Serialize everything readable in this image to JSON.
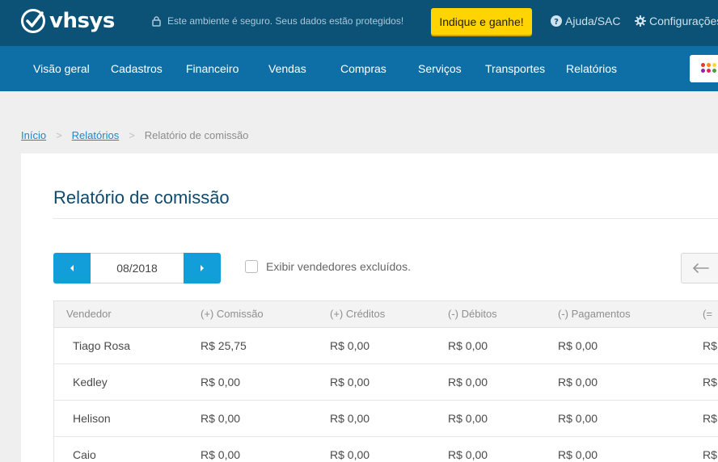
{
  "header": {
    "brand": "vhsys",
    "secure_text": "Este ambiente é seguro. Seus dados estão protegidos!",
    "cta_label": "Indique e ganhe!",
    "help_label": "Ajuda/SAC",
    "settings_label": "Configurações"
  },
  "nav": {
    "items": [
      "Visão geral",
      "Cadastros",
      "Financeiro",
      "Vendas",
      "Compras",
      "Serviços",
      "Transportes",
      "Relatórios"
    ]
  },
  "breadcrumb": {
    "home": "Início",
    "section": "Relatórios",
    "current": "Relatório de comissão",
    "separator": ">"
  },
  "page": {
    "title": "Relatório de comissão",
    "period": "08/2018",
    "show_deleted_label": "Exibir vendedores excluídos.",
    "show_deleted_checked": false
  },
  "table": {
    "columns": [
      "Vendedor",
      "(+) Comissão",
      "(+) Créditos",
      "(-) Débitos",
      "(-) Pagamentos",
      "(="
    ],
    "rows": [
      [
        "Tiago Rosa",
        "R$ 25,75",
        "R$ 0,00",
        "R$ 0,00",
        "R$ 0,00",
        "R$"
      ],
      [
        "Kedley",
        "R$ 0,00",
        "R$ 0,00",
        "R$ 0,00",
        "R$ 0,00",
        "R$"
      ],
      [
        "Helison",
        "R$ 0,00",
        "R$ 0,00",
        "R$ 0,00",
        "R$ 0,00",
        "R$"
      ],
      [
        "Caio",
        "R$ 0,00",
        "R$ 0,00",
        "R$ 0,00",
        "R$ 0,00",
        "R$"
      ]
    ]
  },
  "colors": {
    "topbar": "#0b5276",
    "nav": "#0d6fa6",
    "accent": "#129fd9",
    "cta": "#ffd400",
    "title": "#0d4a6e"
  },
  "icons": [
    "vhsys-logo-icon",
    "lock-icon",
    "help-circle-icon",
    "gear-icon",
    "apps-grid-icon",
    "caret-left-icon",
    "caret-right-icon",
    "arrow-left-icon"
  ]
}
